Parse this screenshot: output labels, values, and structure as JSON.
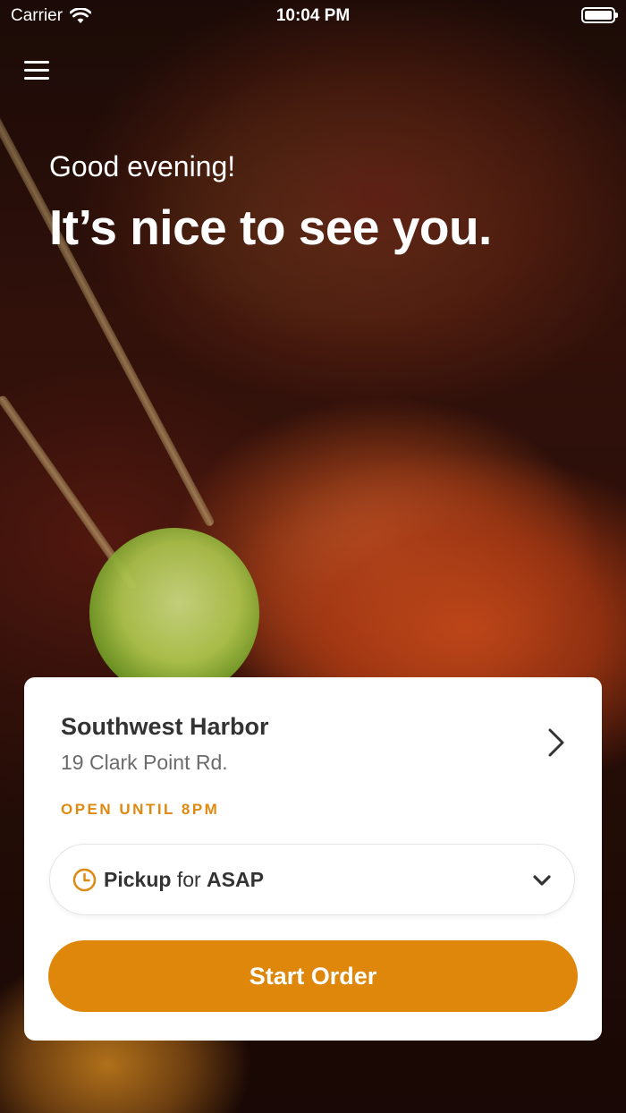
{
  "status_bar": {
    "carrier": "Carrier",
    "time": "10:04 PM"
  },
  "hero": {
    "greeting": "Good evening!",
    "headline": "It’s nice to see you."
  },
  "location": {
    "name": "Southwest Harbor",
    "address": "19 Clark Point Rd.",
    "hours_status": "OPEN UNTIL 8PM"
  },
  "order_mode": {
    "mode": "Pickup",
    "connector": "for",
    "time": "ASAP"
  },
  "actions": {
    "start_order": "Start Order"
  },
  "colors": {
    "accent": "#df870a",
    "hours_status": "#de8910"
  },
  "icons": [
    "wifi-icon",
    "battery-icon",
    "menu-icon",
    "chevron-right-icon",
    "clock-icon",
    "chevron-down-icon"
  ]
}
